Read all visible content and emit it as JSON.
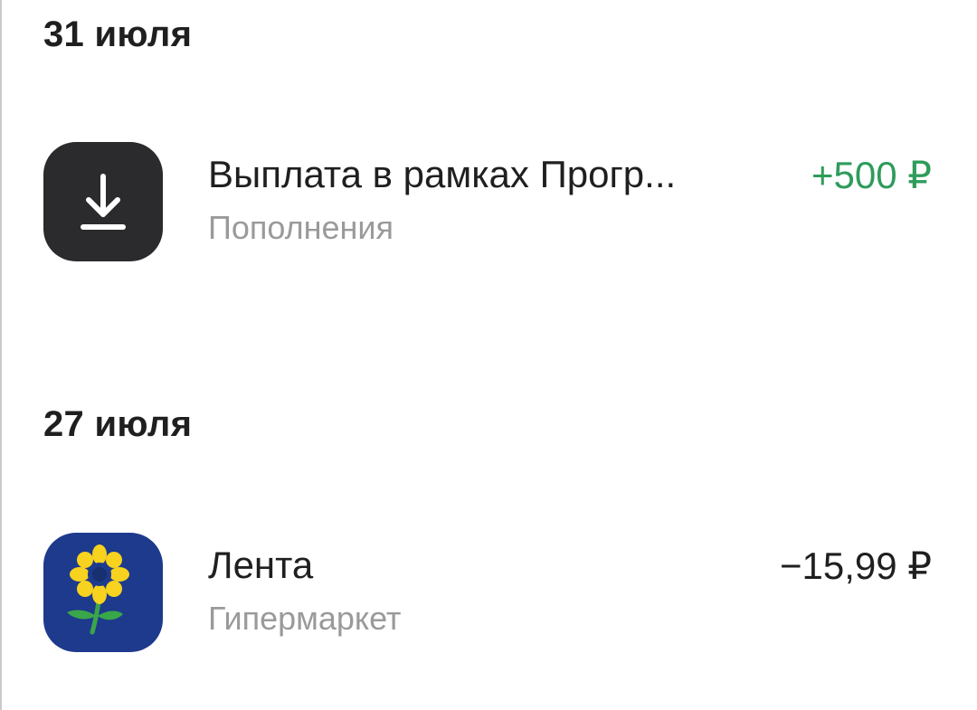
{
  "groups": [
    {
      "date": "31 июля",
      "transactions": [
        {
          "title": "Выплата в рамках Прогр...",
          "category": "Пополнения",
          "amount": "+500 ₽",
          "icon": "download-icon",
          "icon_bg": "#2b2b2d",
          "amount_color": "#2e9c5b"
        }
      ]
    },
    {
      "date": "27 июля",
      "transactions": [
        {
          "title": "Лента",
          "category": "Гипермаркет",
          "amount": "−15,99 ₽",
          "icon": "sunflower-logo-icon",
          "icon_bg": "#1d3a8c",
          "amount_color": "#1f1f1f"
        }
      ]
    }
  ]
}
